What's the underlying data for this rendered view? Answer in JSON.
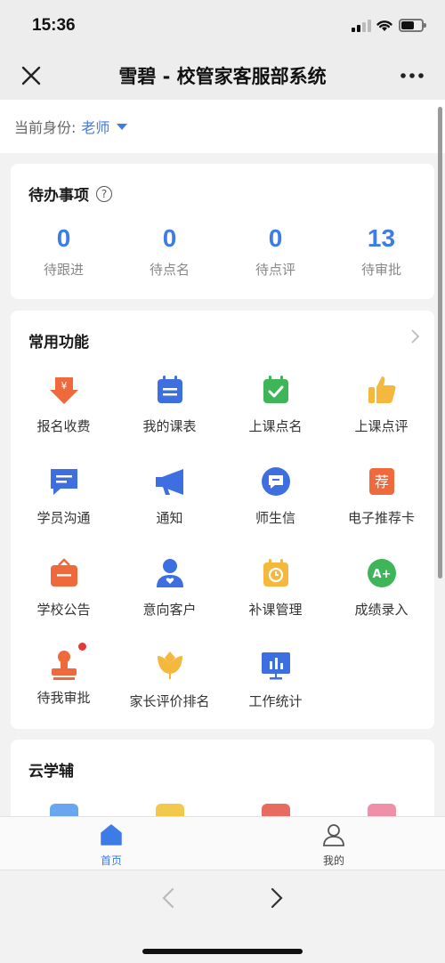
{
  "status_bar": {
    "time": "15:36"
  },
  "nav": {
    "title": "雪碧 - 校管家客服部系统",
    "close_icon": "close-icon",
    "more_icon": "more-icon"
  },
  "identity": {
    "label": "当前身份:",
    "value": "老师"
  },
  "todo": {
    "title": "待办事项",
    "stats": [
      {
        "count": "0",
        "label": "待跟进"
      },
      {
        "count": "0",
        "label": "待点名"
      },
      {
        "count": "0",
        "label": "待点评"
      },
      {
        "count": "13",
        "label": "待审批"
      }
    ]
  },
  "functions": {
    "title": "常用功能",
    "items": [
      {
        "label": "报名收费",
        "icon": "payment-icon"
      },
      {
        "label": "我的课表",
        "icon": "schedule-icon"
      },
      {
        "label": "上课点名",
        "icon": "roll-call-icon"
      },
      {
        "label": "上课点评",
        "icon": "thumbs-up-icon"
      },
      {
        "label": "学员沟通",
        "icon": "chat-icon"
      },
      {
        "label": "通知",
        "icon": "megaphone-icon"
      },
      {
        "label": "师生信",
        "icon": "letter-icon"
      },
      {
        "label": "电子推荐卡",
        "icon": "recommend-card-icon",
        "icon_text": "荐"
      },
      {
        "label": "学校公告",
        "icon": "announcement-icon"
      },
      {
        "label": "意向客户",
        "icon": "customer-icon"
      },
      {
        "label": "补课管理",
        "icon": "makeup-class-icon"
      },
      {
        "label": "成绩录入",
        "icon": "grade-entry-icon",
        "icon_text": "A+"
      },
      {
        "label": "待我审批",
        "icon": "approval-stamp-icon",
        "badge": true
      },
      {
        "label": "家长评价排名",
        "icon": "flower-icon"
      },
      {
        "label": "工作统计",
        "icon": "statistics-icon"
      }
    ]
  },
  "cloud": {
    "title": "云学辅",
    "colors": [
      "#6aa6f0",
      "#f2c94c",
      "#e86b5f",
      "#f08fa8"
    ]
  },
  "tabs": [
    {
      "label": "首页",
      "icon": "home-icon",
      "active": true
    },
    {
      "label": "我的",
      "icon": "user-icon",
      "active": false
    }
  ],
  "colors": {
    "accent": "#3d7ce6",
    "badge": "#e53935"
  }
}
